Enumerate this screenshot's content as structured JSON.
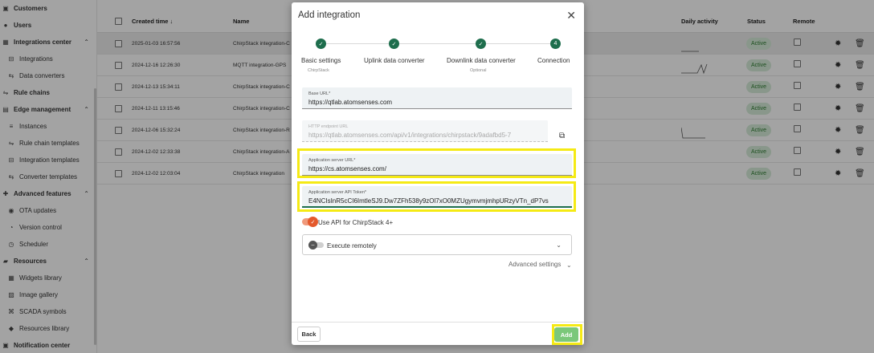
{
  "sidebar": {
    "items": [
      {
        "label": "Customers",
        "icon": "customers-icon",
        "glyph": "▣"
      },
      {
        "label": "Users",
        "icon": "users-icon",
        "glyph": "●"
      },
      {
        "label": "Integrations center",
        "icon": "integrations-icon",
        "glyph": "▦"
      },
      {
        "label": "Integrations",
        "icon": "integration-icon",
        "glyph": "⊟"
      },
      {
        "label": "Data converters",
        "icon": "converter-icon",
        "glyph": "⇆"
      },
      {
        "label": "Rule chains",
        "icon": "rule-chain-icon",
        "glyph": "⇋"
      },
      {
        "label": "Edge management",
        "icon": "edge-icon",
        "glyph": "▤"
      },
      {
        "label": "Instances",
        "icon": "instances-icon",
        "glyph": "≡"
      },
      {
        "label": "Rule chain templates",
        "icon": "rule-template-icon",
        "glyph": "⇋"
      },
      {
        "label": "Integration templates",
        "icon": "integration-template-icon",
        "glyph": "⊟"
      },
      {
        "label": "Converter templates",
        "icon": "converter-template-icon",
        "glyph": "⇆"
      },
      {
        "label": "Advanced features",
        "icon": "advanced-icon",
        "glyph": "✚"
      },
      {
        "label": "OTA updates",
        "icon": "ota-icon",
        "glyph": "◉"
      },
      {
        "label": "Version control",
        "icon": "version-icon",
        "glyph": "◔"
      },
      {
        "label": "Scheduler",
        "icon": "scheduler-icon",
        "glyph": "◷"
      },
      {
        "label": "Resources",
        "icon": "resources-icon",
        "glyph": "▰"
      },
      {
        "label": "Widgets library",
        "icon": "widgets-icon",
        "glyph": "▦"
      },
      {
        "label": "Image gallery",
        "icon": "image-icon",
        "glyph": "▨"
      },
      {
        "label": "SCADA symbols",
        "icon": "scada-icon",
        "glyph": "⌘"
      },
      {
        "label": "Resources library",
        "icon": "library-icon",
        "glyph": "◆"
      },
      {
        "label": "Notification center",
        "icon": "notification-icon",
        "glyph": "▣"
      }
    ]
  },
  "table": {
    "headers": {
      "created": "Created time ↓",
      "name": "Name",
      "activity": "Daily activity",
      "status": "Status",
      "remote": "Remote"
    },
    "rows": [
      {
        "created": "2025-01-03 16:57:56",
        "name": "ChirpStack integration-C",
        "status": "Active"
      },
      {
        "created": "2024-12-16 12:26:30",
        "name": "MQTT integration-GPS",
        "status": "Active"
      },
      {
        "created": "2024-12-13 15:34:11",
        "name": "ChirpStack integration-C",
        "status": "Active"
      },
      {
        "created": "2024-12-11 13:15:46",
        "name": "ChirpStack integration-C",
        "status": "Active"
      },
      {
        "created": "2024-12-06 15:32:24",
        "name": "ChirpStack integration-R",
        "status": "Active"
      },
      {
        "created": "2024-12-02 12:33:38",
        "name": "ChirpStack integration-A",
        "status": "Active"
      },
      {
        "created": "2024-12-02 12:03:04",
        "name": "ChirpStack integration",
        "status": "Active"
      }
    ]
  },
  "modal": {
    "title": "Add integration",
    "close_glyph": "✕",
    "steps": [
      {
        "label": "Basic settings",
        "sub": "ChirpStack",
        "mark": "✓"
      },
      {
        "label": "Uplink data converter",
        "sub": "",
        "mark": "✓"
      },
      {
        "label": "Downlink data converter",
        "sub": "Optional",
        "mark": "✓"
      },
      {
        "label": "Connection",
        "sub": "",
        "mark": "4"
      }
    ],
    "base_url": {
      "label": "Base URL*",
      "value": "https://qtlab.atomsenses.com"
    },
    "http_endpoint": {
      "label": "HTTP endpoint URL",
      "value": "https://qtlab.atomsenses.com/api/v1/integrations/chirpstack/9adafbd5-7"
    },
    "app_server_url": {
      "label": "Application server URL*",
      "value": "https://cs.atomsenses.com/"
    },
    "app_server_token": {
      "label": "Application server API Token*",
      "value": "E4NCIsInR5cCI6ImtleSJ9.Dw7ZFh538y9zOl7xO0MZUgymvmjmhpURzyVTn_dP7vs"
    },
    "use_api_label": "Use API for ChirpStack 4+",
    "execute_remotely": "Execute remotely",
    "advanced_settings": "Advanced settings",
    "back_label": "Back",
    "add_label": "Add"
  },
  "colors": {
    "accent": "#1e6e4d",
    "highlight": "#f5ea14",
    "toggle": "#e4592c",
    "add_button": "#7bc87a"
  }
}
